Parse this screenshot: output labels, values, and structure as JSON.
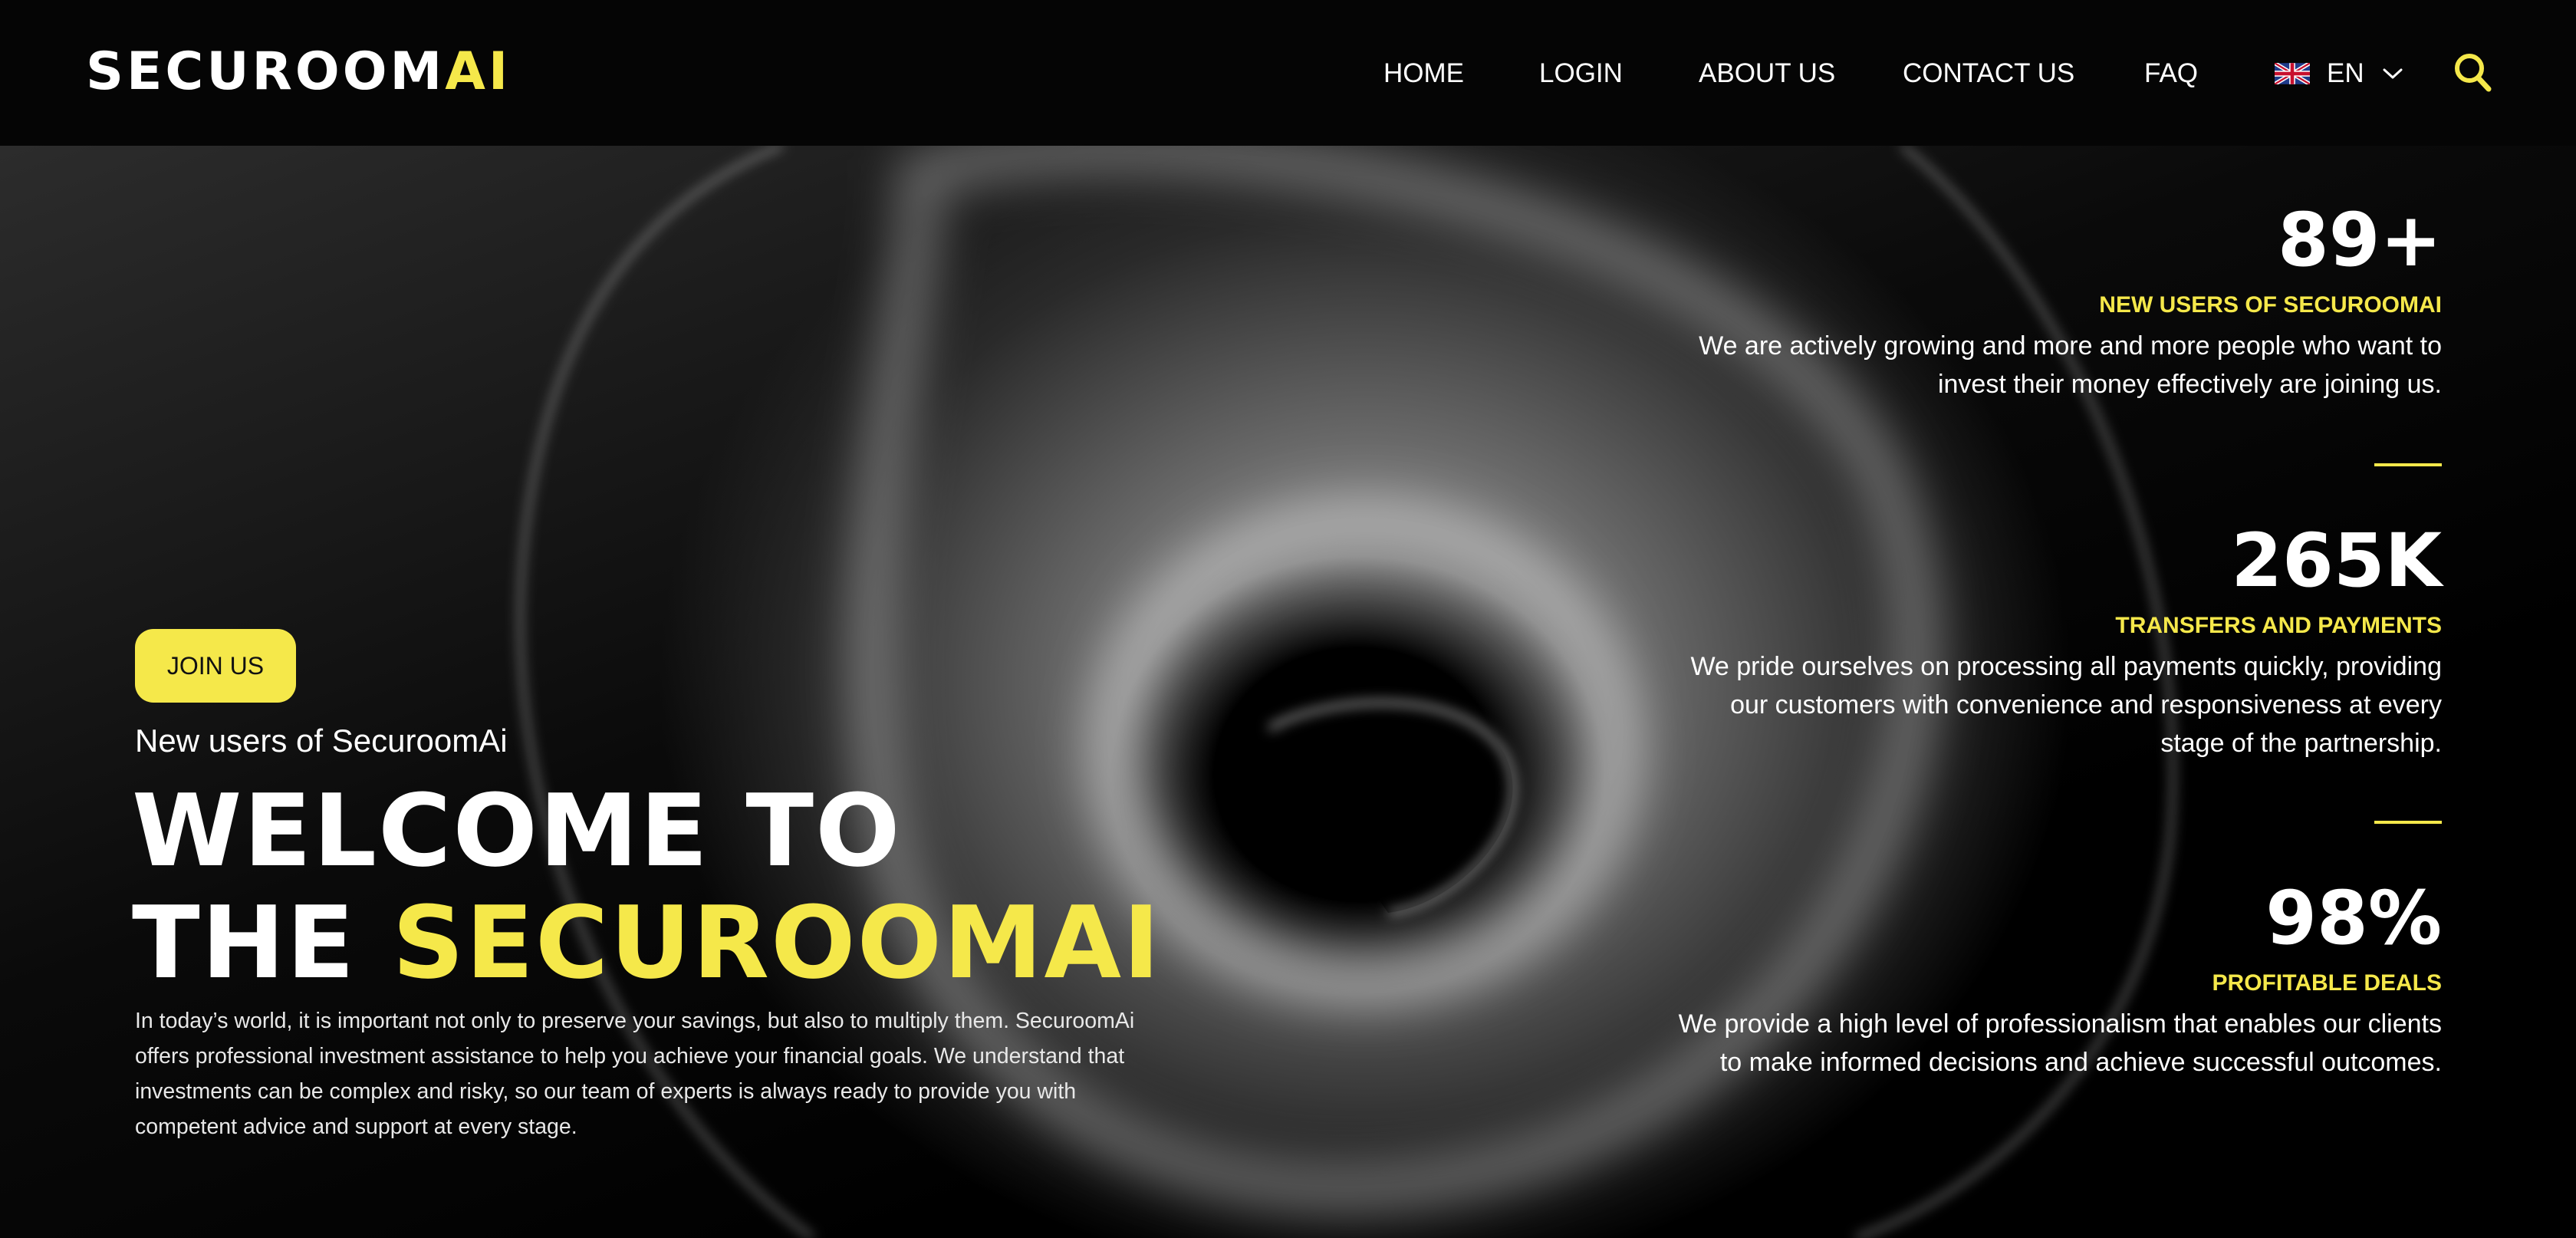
{
  "brand": {
    "name_main": "SECUROOM",
    "name_accent": "AI",
    "accent_color": "#f5e84a"
  },
  "nav": {
    "items": [
      {
        "label": "HOME"
      },
      {
        "label": "LOGIN"
      },
      {
        "label": "ABOUT US"
      },
      {
        "label": "CONTACT US"
      },
      {
        "label": "FAQ"
      }
    ],
    "language": {
      "code": "EN",
      "flag": "uk-flag-icon"
    },
    "search_icon": "search-icon"
  },
  "hero": {
    "join_label": "JOIN US",
    "subtitle": "New users of SecuroomAi",
    "title_line1": "WELCOME TO",
    "title_line2_plain": "THE ",
    "title_line2_accent": "SECUROOMAI",
    "description": "In today’s world, it is important not only to preserve your savings, but also to multiply them. SecuroomAi offers professional investment assistance to help you achieve your financial goals. We understand that investments can be complex and risky, so our team of experts is always ready to provide you with competent advice and support at every stage."
  },
  "stats": [
    {
      "value": "89+",
      "label": "NEW USERS OF SECUROOMAI",
      "description": "We are actively growing and more and more people who want to invest their money effectively are joining us."
    },
    {
      "value": "265K",
      "label": "TRANSFERS AND PAYMENTS",
      "description": "We pride ourselves on processing all payments quickly, providing our customers with convenience and responsiveness at every stage of the partnership."
    },
    {
      "value": "98%",
      "label": "PROFITABLE DEALS",
      "description": "We provide a high level of professionalism that enables our clients to make informed decisions and achieve successful outcomes."
    }
  ]
}
